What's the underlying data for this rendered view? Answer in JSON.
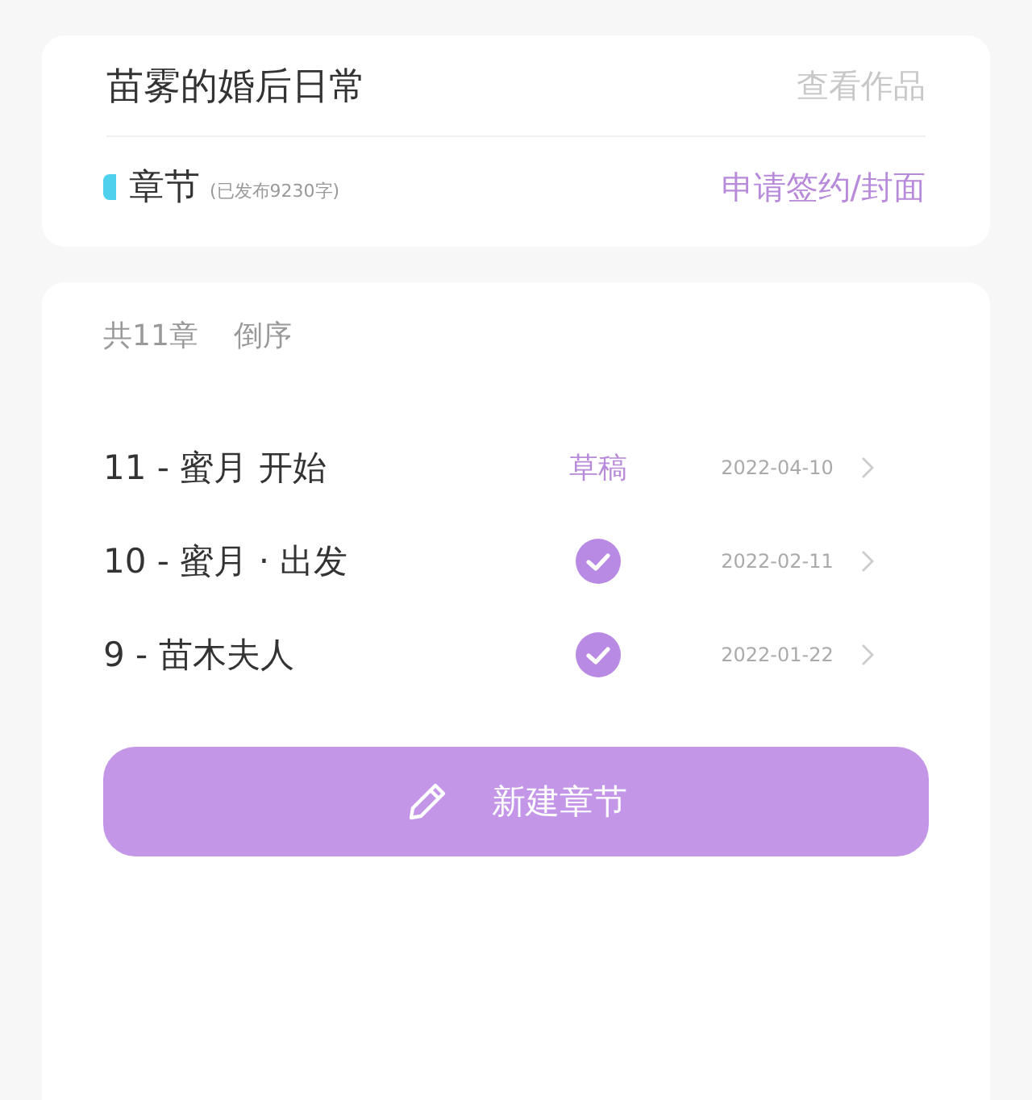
{
  "work": {
    "title": "苗雾的婚后日常",
    "view_link": "查看作品",
    "section_label": "章节",
    "published_note": "(已发布9230字)",
    "sign_link": "申请签约/封面"
  },
  "chapters_header": {
    "count": "共11章",
    "sort": "倒序"
  },
  "chapters": [
    {
      "title": "11 - 蜜月 开始",
      "kind": "draft",
      "status": "草稿",
      "date": "2022-04-10"
    },
    {
      "title": "10 - 蜜月 · 出发",
      "kind": "published",
      "date": "2022-02-11"
    },
    {
      "title": "9 - 苗木夫人",
      "kind": "published",
      "date": "2022-01-22"
    }
  ],
  "new_chapter_button": "新建章节"
}
